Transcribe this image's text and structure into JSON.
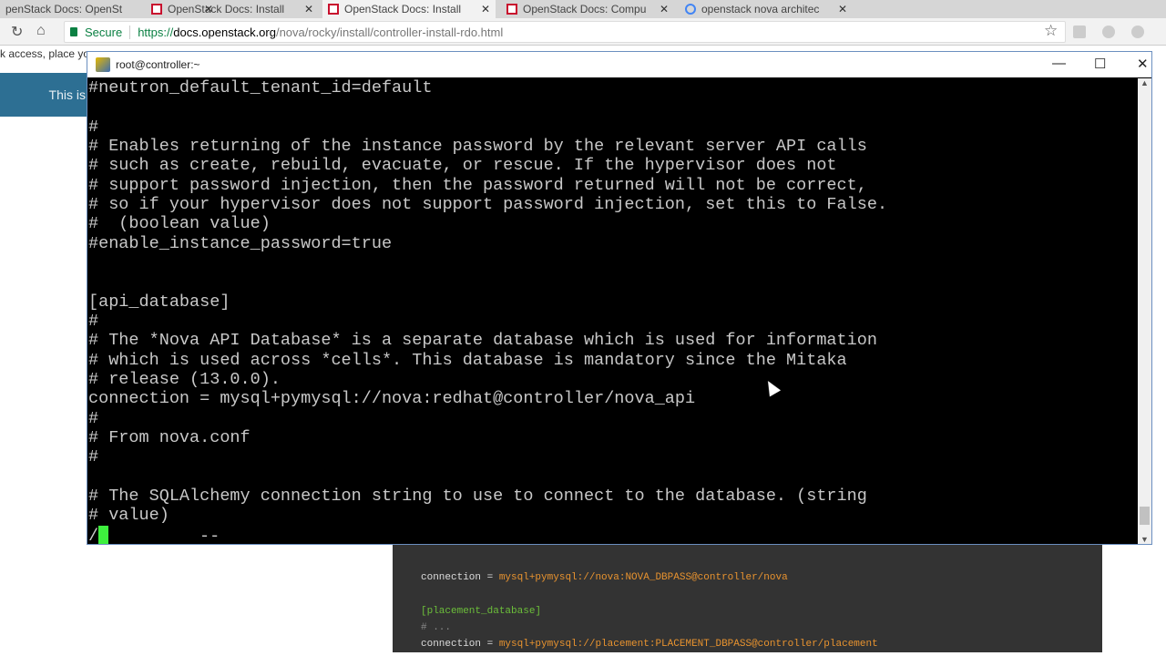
{
  "browser": {
    "tabs": [
      {
        "label": "penStack Docs: OpenSt",
        "active": false
      },
      {
        "label": "OpenStack Docs: Install",
        "active": false
      },
      {
        "label": "OpenStack Docs: Install",
        "active": true
      },
      {
        "label": "OpenStack Docs: Compu",
        "active": false
      },
      {
        "label": "openstack nova architec",
        "active": false
      }
    ],
    "secure_label": "Secure",
    "url_scheme": "https://",
    "url_host": "docs.openstack.org",
    "url_path": "/nova/rocky/install/controller-install-rdo.html"
  },
  "page": {
    "snippet": "k access, place yo",
    "banner": "This is",
    "code_lines": [
      {
        "plain": "connection = ",
        "value": "mysql+pymysql://nova:NOVA_DBPASS@controller/nova"
      },
      {
        "section": "[placement_database]"
      },
      {
        "comment": "# ..."
      },
      {
        "plain": "connection = ",
        "value": "mysql+pymysql://placement:PLACEMENT_DBPASS@controller/placement"
      }
    ]
  },
  "terminal": {
    "title": "root@controller:~",
    "lines": [
      "#neutron_default_tenant_id=default",
      "",
      "#",
      "# Enables returning of the instance password by the relevant server API calls",
      "# such as create, rebuild, evacuate, or rescue. If the hypervisor does not",
      "# support password injection, then the password returned will not be correct,",
      "# so if your hypervisor does not support password injection, set this to False.",
      "#  (boolean value)",
      "#enable_instance_password=true",
      "",
      "",
      "[api_database]",
      "#",
      "# The *Nova API Database* is a separate database which is used for information",
      "# which is used across *cells*. This database is mandatory since the Mitaka",
      "# release (13.0.0).",
      "connection = mysql+pymysql://nova:redhat@controller/nova_api",
      "#",
      "# From nova.conf",
      "#",
      "",
      "# The SQLAlchemy connection string to use to connect to the database. (string",
      "# value)"
    ],
    "prompt_prefix": "/",
    "prompt_suffix": "         --"
  }
}
